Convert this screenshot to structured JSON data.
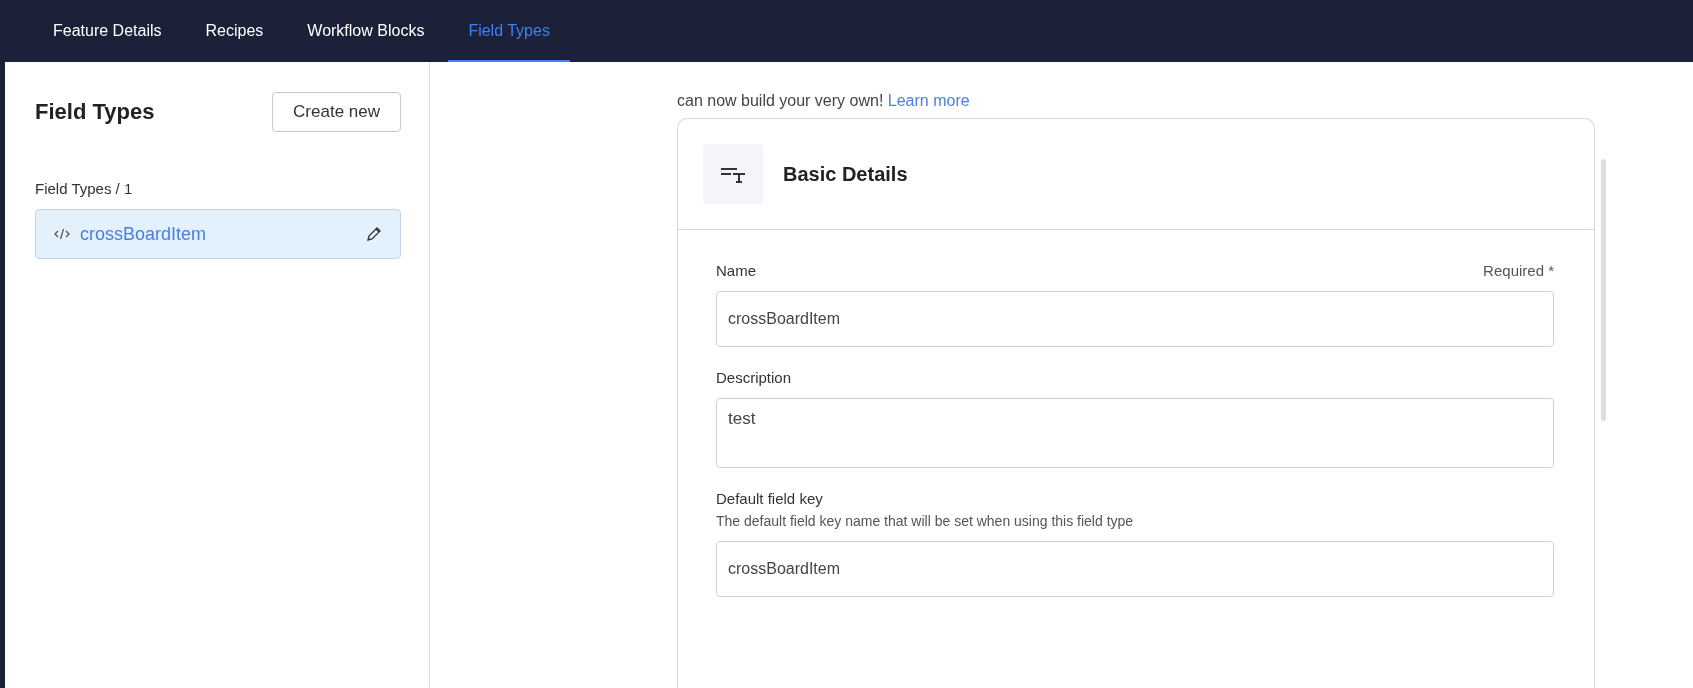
{
  "tabs": [
    {
      "label": "Feature Details",
      "selected": false
    },
    {
      "label": "Recipes",
      "selected": false
    },
    {
      "label": "Workflow Blocks",
      "selected": false
    },
    {
      "label": "Field Types",
      "selected": true
    }
  ],
  "sidebar": {
    "title": "Field Types",
    "create_button": "Create new",
    "breadcrumb": "Field Types / 1",
    "items": [
      {
        "label": "crossBoardItem",
        "selected": true
      }
    ]
  },
  "intro": {
    "text": "can now build your very own!",
    "link": "Learn more"
  },
  "card": {
    "title": "Basic Details",
    "fields": [
      {
        "kind": "input",
        "label": "Name",
        "required": "Required *",
        "value": "crossBoardItem"
      },
      {
        "kind": "textarea",
        "label": "Description",
        "value": "test"
      },
      {
        "kind": "input",
        "label": "Default field key",
        "hint": "The default field key name that will be set when using this field type",
        "value": "crossBoardItem"
      }
    ]
  }
}
